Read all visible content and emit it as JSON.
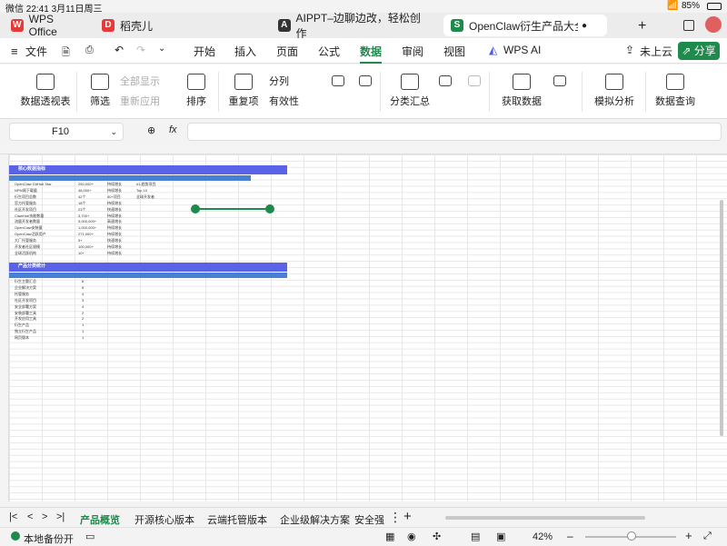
{
  "status": {
    "left": "微信  22:41  3月11日周三",
    "battery": "85%"
  },
  "tabs": [
    {
      "label": "WPS Office",
      "icon": "wps-logo-icon"
    },
    {
      "label": "稻壳儿",
      "icon": "docer-icon"
    },
    {
      "label": "AIPPT–边聊边改，轻松创作",
      "icon": "aippt-icon"
    },
    {
      "label": "OpenClaw衍生产品大全统",
      "icon": "sheet-icon"
    }
  ],
  "menu": {
    "file": "文件",
    "items": [
      "开始",
      "插入",
      "页面",
      "公式",
      "数据",
      "审阅",
      "视图"
    ],
    "ai": "WPS AI",
    "cloud": "未上云",
    "share": "分享"
  },
  "ribbon": {
    "pivot": "数据透视表",
    "filter": "筛选",
    "show_all": "全部显示",
    "reapply": "重新应用",
    "sort": "排序",
    "duplicates": "重复项",
    "split": "分列",
    "validity": "有效性",
    "subtotal": "分类汇总",
    "get_data": "获取数据",
    "what_if": "模拟分析",
    "query": "数据查询"
  },
  "formula_bar": {
    "cell": "F10",
    "fx": "fx"
  },
  "sheet": {
    "section1_title": "核心数据指标",
    "section2_title": "产品分类统计",
    "rows1": [
      [
        "OpenClaw GitHub Star",
        "250,000+",
        "持续增长",
        "#1 趋势项目"
      ],
      [
        "NPM周下载量",
        "48,000+",
        "持续增长",
        "Top 10"
      ],
      [
        "衍生项目总数",
        "42个",
        "40+项目",
        "全球开发者"
      ],
      [
        "官方托管服务",
        "18个",
        "持续增长"
      ],
      [
        "社区开发项目",
        "23个",
        "快速增长"
      ],
      [
        "ClawHub技能数量",
        "3,700+",
        "持续增长"
      ],
      [
        "流量开发者数量",
        "5,000,000+",
        "高速增长"
      ],
      [
        "OpenClaw安装量",
        "1,000,000+",
        "持续增长"
      ],
      [
        "OpenClaw活跃用户",
        "271,000+",
        "持续增长"
      ],
      [
        "大厂托管服务",
        "5+",
        "快速增长"
      ],
      [
        "开发者社区规模",
        "100,000+",
        "持续增长"
      ],
      [
        "全球活跃机构",
        "10+",
        "持续增长"
      ]
    ],
    "rows2": [
      [
        "衍生主题汇总",
        "8"
      ],
      [
        "企业解决方案",
        "8"
      ],
      [
        "托管服务",
        "4"
      ],
      [
        "社区开发项目",
        "3"
      ],
      [
        "安全部署方案",
        "4"
      ],
      [
        "安装部署工具",
        "2"
      ],
      [
        "开发应用工具",
        "2"
      ],
      [
        "衍生产品",
        "1"
      ],
      [
        "独立衍生产品",
        "1"
      ],
      [
        "网页版本",
        "1"
      ]
    ]
  },
  "sheet_tabs": [
    "产品概览",
    "开源核心版本",
    "云端托管版本",
    "企业级解决方案",
    "安全强"
  ],
  "bottom": {
    "backup": "本地备份开",
    "zoom": "42%"
  }
}
